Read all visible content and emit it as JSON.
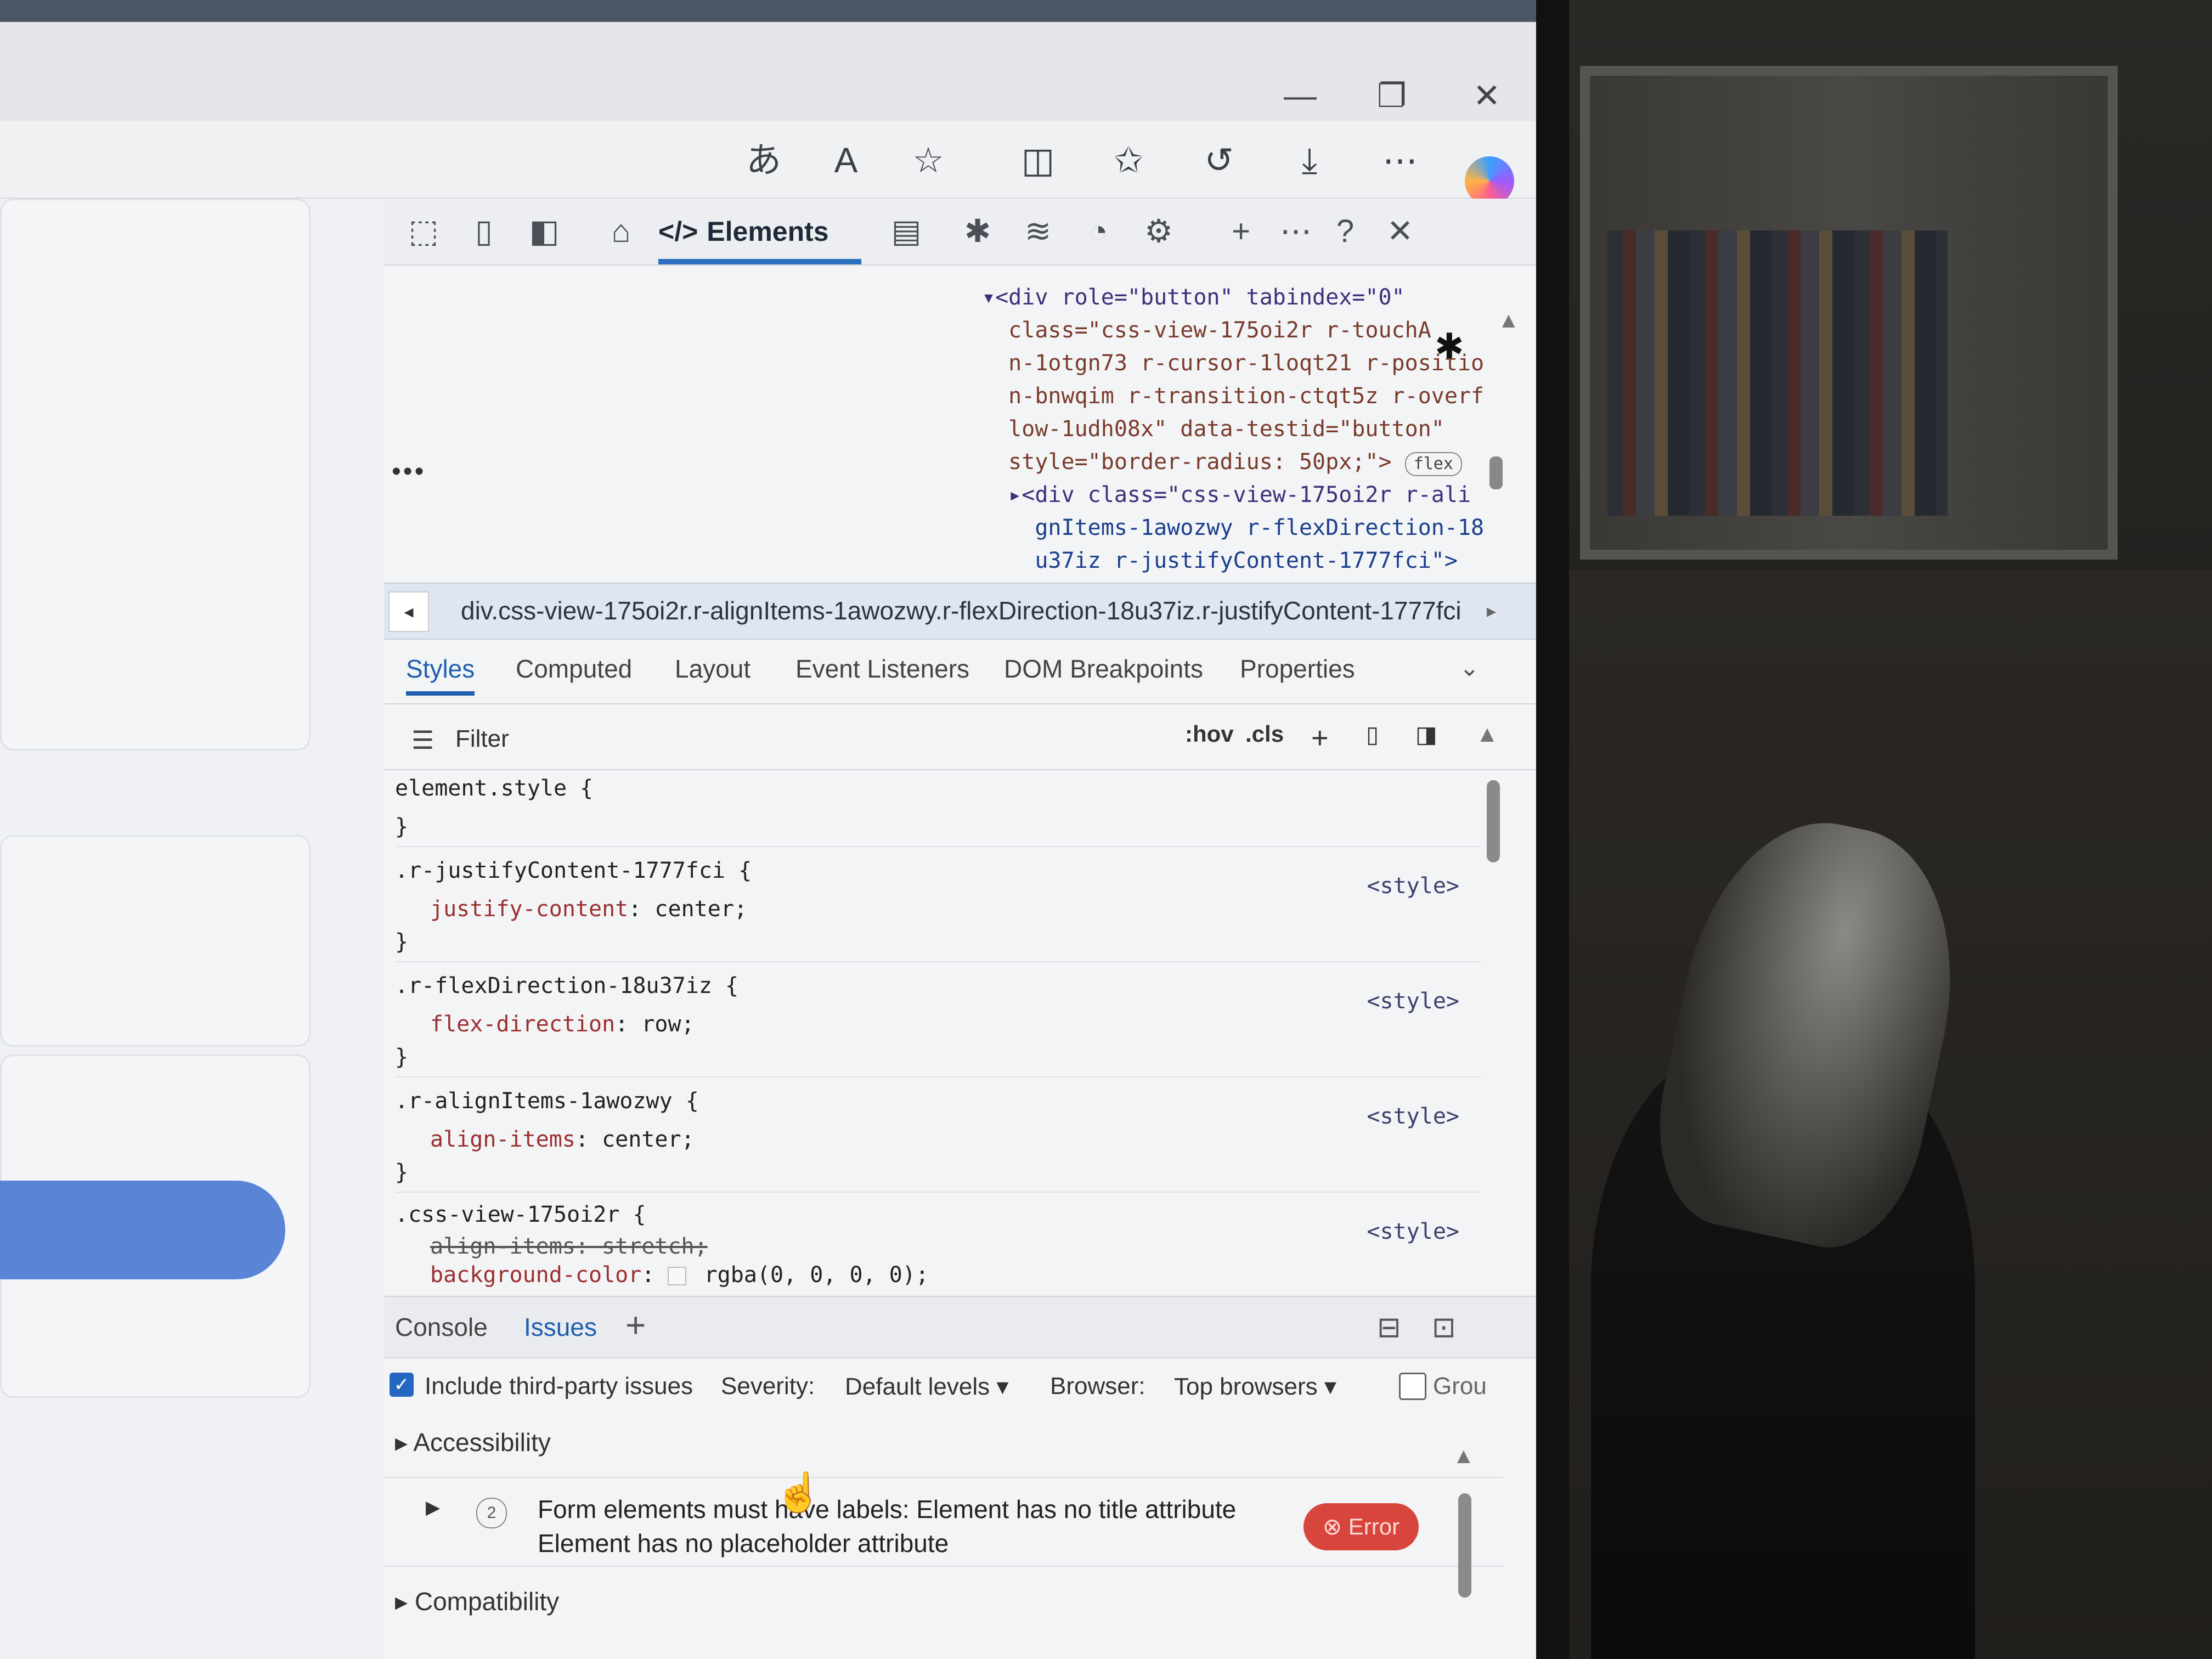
{
  "window": {
    "controls": {
      "minimize": "—",
      "restore": "❐",
      "close": "✕"
    }
  },
  "browser_toolbar": {
    "icons": [
      "translate-icon",
      "read-aloud-icon",
      "favorite-star-icon",
      "split-screen-icon",
      "favorites-icon",
      "history-icon",
      "download-icon",
      "more-icon",
      "copilot-icon"
    ]
  },
  "devtools": {
    "tabs": {
      "elements_label": "Elements",
      "icons": [
        "inspect-icon",
        "device-emulation-icon",
        "dock-icon",
        "welcome-home-icon",
        "console-icon",
        "sources-icon",
        "network-icon",
        "performance-icon",
        "settings-icon",
        "add-tab-icon",
        "more-icon",
        "help-icon",
        "close-icon"
      ]
    },
    "dom_tree": {
      "lines": [
        "▾<div role=\"button\" tabindex=\"0\"",
        "  class=\"css-view-175oi2r r-touchA",
        "  n-1otgn73 r-cursor-1loqt21 r-positio",
        "  n-bnwqim r-transition-ctqt5z r-overf",
        "  low-1udh08x\" data-testid=\"button\"",
        "  style=\"border-radius: 50px;\">",
        "  ▸<div class=\"css-view-175oi2r r-ali",
        "    gnItems-1awozwy r-flexDirection-18",
        "    u37iz r-justifyContent-1777fci\">"
      ],
      "flex_badge": "flex"
    },
    "breadcrumb": "div.css-view-175oi2r.r-alignItems-1awozwy.r-flexDirection-18u37iz.r-justifyContent-1777fci",
    "subtabs": [
      "Styles",
      "Computed",
      "Layout",
      "Event Listeners",
      "DOM Breakpoints",
      "Properties"
    ],
    "filter": {
      "label": "Filter",
      "hov": ":hov",
      "cls": ".cls"
    },
    "styles": {
      "element_style": "element.style {",
      "close_brace": "}",
      "rules": [
        {
          "selector": ".r-justifyContent-1777fci {",
          "prop": "justify-content",
          "value": " center;",
          "source": "<style>"
        },
        {
          "selector": ".r-flexDirection-18u37iz {",
          "prop": "flex-direction",
          "value": " row;",
          "source": "<style>"
        },
        {
          "selector": ".r-alignItems-1awozwy {",
          "prop": "align-items",
          "value": " center;",
          "source": "<style>"
        }
      ],
      "last_rule": {
        "selector": ".css-view-175oi2r {",
        "struck": "align-items: stretch;",
        "prop": "background-color",
        "value": " rgba(0, 0, 0, 0);",
        "source": "<style>"
      }
    },
    "drawer": {
      "tabs": [
        "Console",
        "Issues"
      ],
      "active": "Issues"
    },
    "issues": {
      "include_third_party": "Include third-party issues",
      "severity_label": "Severity:",
      "severity_value": "Default levels",
      "browser_label": "Browser:",
      "browser_value": "Top browsers",
      "group_label": "Grou",
      "accessibility": "Accessibility",
      "issue_count": "2",
      "issue_line1": "Form elements must have labels: Element has no title attribute",
      "issue_line2": "Element has no placeholder attribute",
      "error_badge": "Error",
      "compatibility": "Compatibility"
    }
  }
}
